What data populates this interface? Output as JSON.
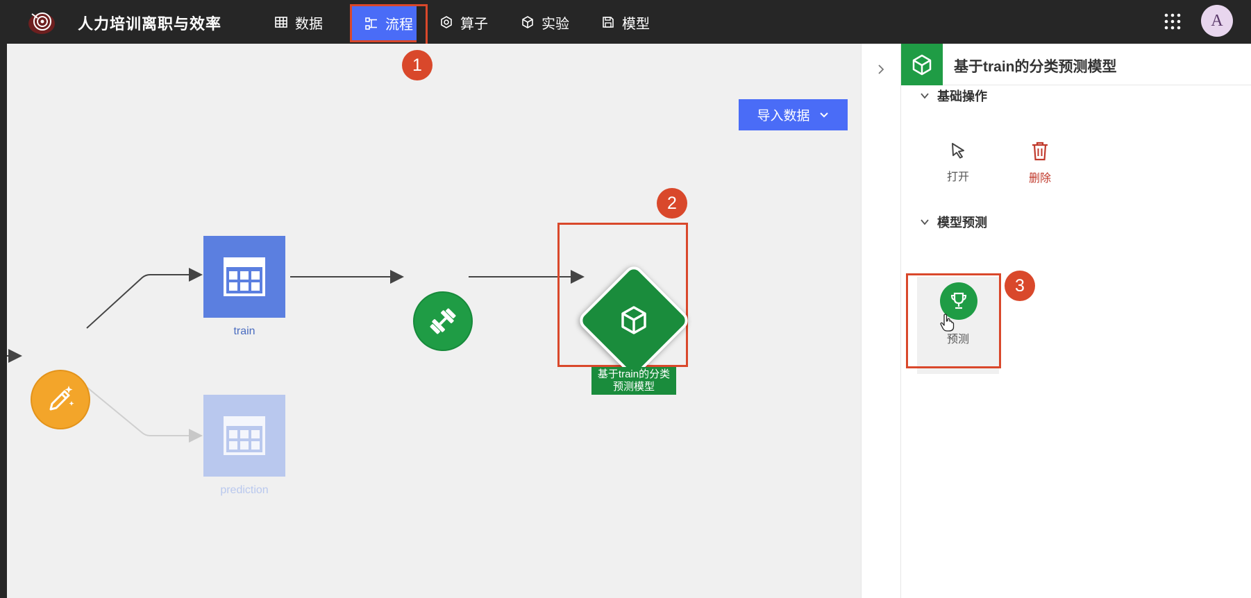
{
  "app": {
    "title": "人力培训离职与效率"
  },
  "nav": {
    "items": [
      {
        "label": "数据",
        "icon": "table-icon"
      },
      {
        "label": "流程",
        "icon": "flow-icon",
        "active": true
      },
      {
        "label": "算子",
        "icon": "hexagon-icon"
      },
      {
        "label": "实验",
        "icon": "cube-icon"
      },
      {
        "label": "模型",
        "icon": "save-icon"
      }
    ],
    "avatar": "A"
  },
  "canvas": {
    "import_label": "导入数据",
    "nodes": {
      "train_label": "train",
      "prediction_label": "prediction",
      "model_label": "基于train的分类预测模型"
    },
    "badges": [
      "1",
      "2",
      "3"
    ]
  },
  "panel": {
    "title": "基于train的分类预测模型",
    "sections": [
      {
        "title": "基础操作",
        "actions": [
          {
            "label": "打开",
            "icon": "cursor-icon"
          },
          {
            "label": "删除",
            "icon": "trash-icon"
          }
        ]
      },
      {
        "title": "模型预测",
        "actions": [
          {
            "label": "预测",
            "icon": "trophy-icon"
          }
        ]
      }
    ]
  },
  "colors": {
    "topbar": "#262626",
    "accent_blue": "#4a6cf7",
    "node_blue": "#5b7fe0",
    "green": "#1f9c45",
    "orange": "#f3a52a",
    "highlight_red": "#d9482b",
    "delete_red": "#c0392b"
  }
}
